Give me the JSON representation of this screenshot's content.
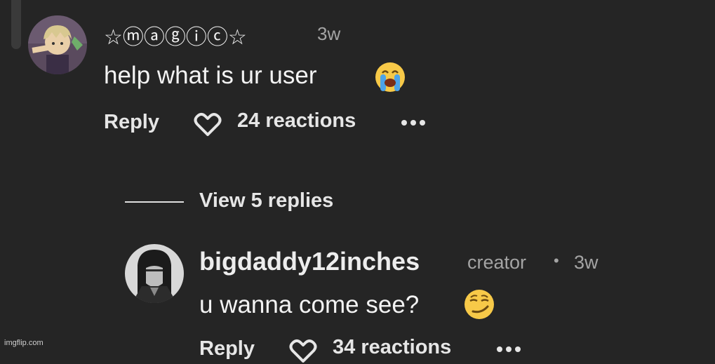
{
  "comments": [
    {
      "username": "☆ⓜⓐⓖⓘⓒ☆",
      "time": "3w",
      "text": "help what is ur user",
      "emoji": "loudly-crying-face",
      "reply_label": "Reply",
      "reactions": "24 reactions"
    }
  ],
  "thread": {
    "view_replies": "View 5 replies"
  },
  "replies": [
    {
      "username": "bigdaddy12inches",
      "role": "creator",
      "separator": "•",
      "time": "3w",
      "text": "u wanna come see?",
      "emoji": "smirking-face",
      "reply_label": "Reply",
      "reactions": "34 reactions"
    }
  ],
  "watermark": "imgflip.com",
  "colors": {
    "background": "#252525",
    "text": "#f3f3f3",
    "muted": "#a4a4a4"
  }
}
